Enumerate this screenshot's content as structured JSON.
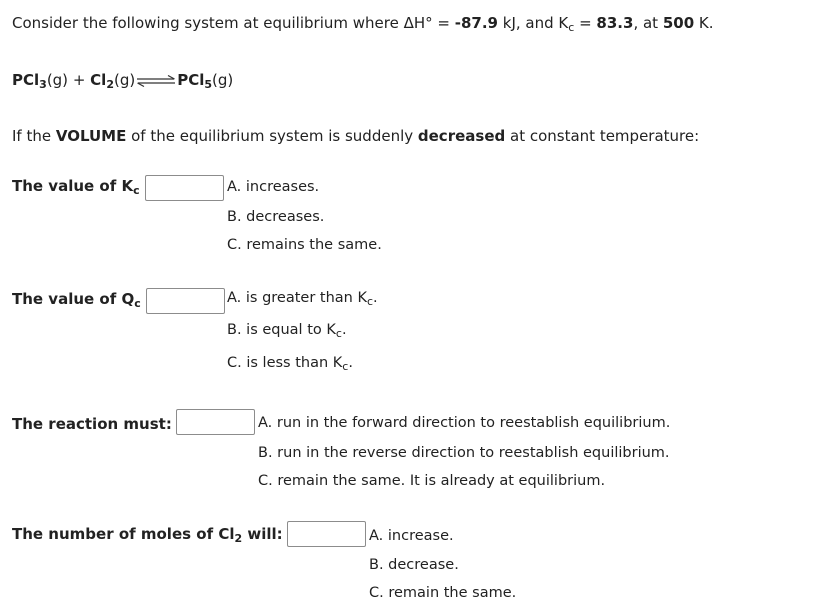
{
  "intro": {
    "prefix": "Consider the following system at equilibrium where ",
    "dh_label": "ΔH° = ",
    "dh_value": "-87.9",
    "dh_unit": " kJ, and ",
    "kc_symbol": "K",
    "kc_sub": "c",
    "kc_eq": " = ",
    "kc_value": "83.3",
    "temp_pre": ", at ",
    "temp_value": "500",
    "temp_unit": " K."
  },
  "reaction": {
    "r1": "PCl",
    "r1_sub": "3",
    "r1_state": "(g)",
    "plus": " + ",
    "r2": "Cl",
    "r2_sub": "2",
    "r2_state": "(g)",
    "p1": "PCl",
    "p1_sub": "5",
    "p1_state": "(g)",
    "arrow_icon": "equilibrium-arrow"
  },
  "condition": {
    "pre": "If the ",
    "bold1": "VOLUME",
    "mid": " of the equilibrium system is suddenly ",
    "bold2": "decreased",
    "post": " at constant temperature:"
  },
  "questions": [
    {
      "label": "The value of K",
      "label_sub": "c",
      "label_post": "",
      "value": "",
      "options": [
        {
          "text": "A. increases."
        },
        {
          "text": "B. decreases."
        },
        {
          "text": "C. remains the same."
        }
      ]
    },
    {
      "label": "The value of Q",
      "label_sub": "c",
      "label_post": "",
      "value": "",
      "options": [
        {
          "text": "A. is greater than K",
          "sub": "c",
          "post": "."
        },
        {
          "text": "B. is equal to K",
          "sub": "c",
          "post": "."
        },
        {
          "text": "C. is less than K",
          "sub": "c",
          "post": "."
        }
      ]
    },
    {
      "label": "The reaction must:",
      "label_sub": "",
      "label_post": "",
      "value": "",
      "options": [
        {
          "text": "A. run in the forward direction to reestablish equilibrium."
        },
        {
          "text": "B. run in the reverse direction to reestablish equilibrium."
        },
        {
          "text": "C. remain the same. It is already at equilibrium."
        }
      ]
    },
    {
      "label": "The number of moles of Cl",
      "label_sub": "2",
      "label_post": " will:",
      "value": "",
      "options": [
        {
          "text": "A. increase."
        },
        {
          "text": "B. decrease."
        },
        {
          "text": "C. remain the same."
        }
      ]
    }
  ]
}
